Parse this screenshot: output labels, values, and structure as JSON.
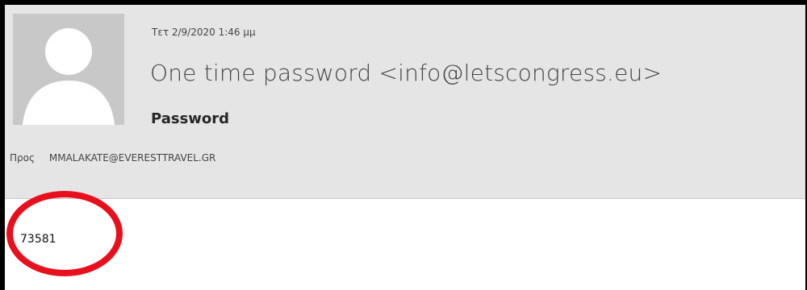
{
  "message": {
    "date": "Τετ 2/9/2020 1:46 μμ",
    "sender": "One time password <info@letscongress.eu>",
    "subject": "Password",
    "to_label": "Προς",
    "to_value": "MMALAKATE@EVERESTTRAVEL.GR",
    "body_code": "73581"
  },
  "icons": {
    "avatar": "default-person-avatar-icon"
  },
  "colors": {
    "header_background": "#e5e5e5",
    "highlight_circle": "#e8101c"
  }
}
